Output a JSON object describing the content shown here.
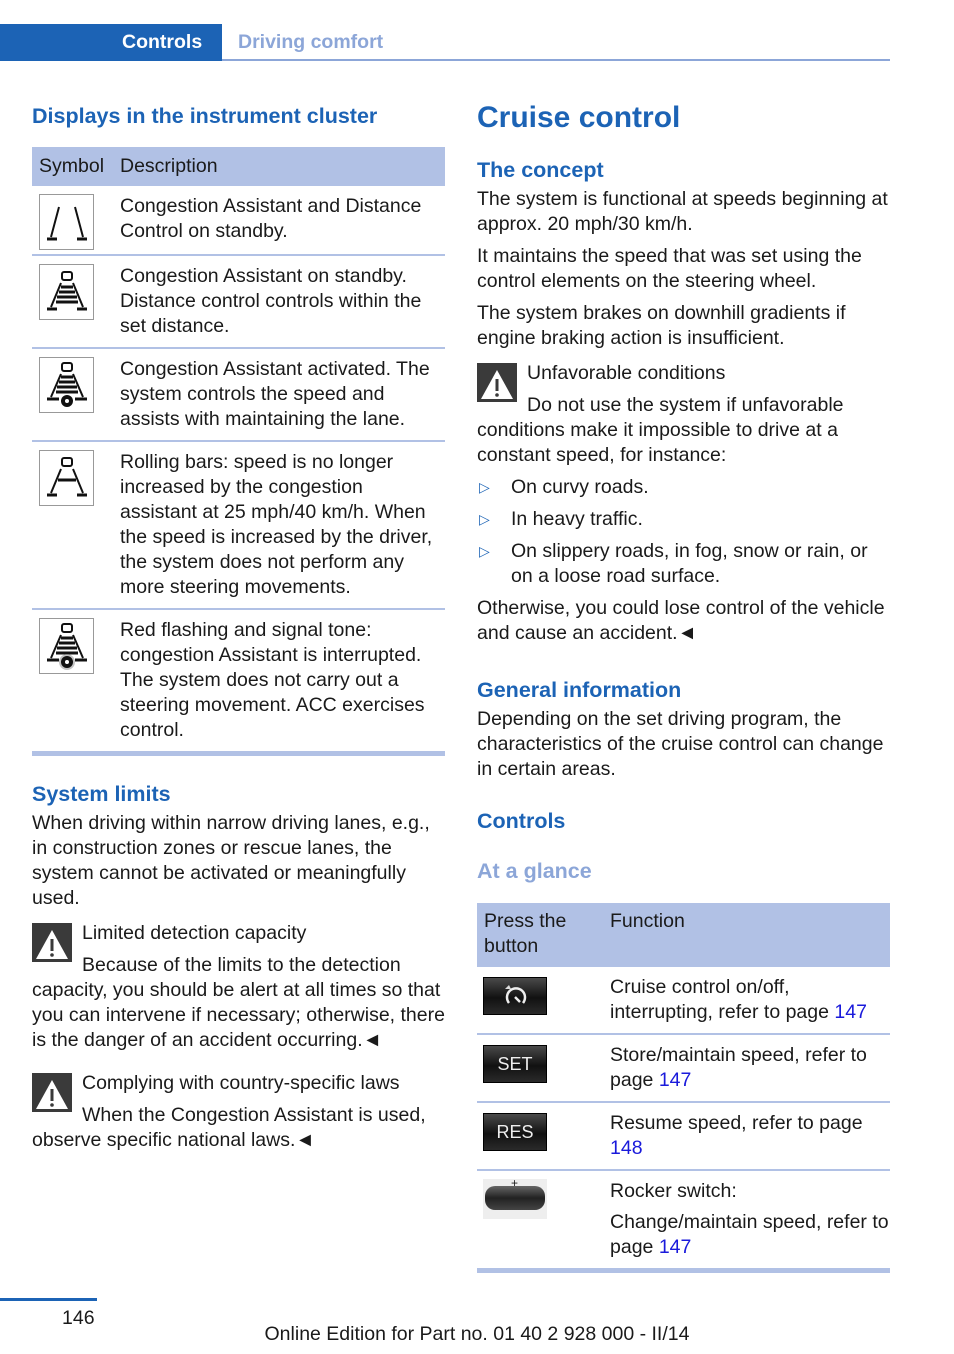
{
  "header": {
    "chapter": "Controls",
    "section": "Driving comfort"
  },
  "left": {
    "displays_heading": "Displays in the instrument cluster",
    "table": {
      "col_symbol": "Symbol",
      "col_description": "Description",
      "rows": [
        {
          "icon": "congestion-standby-lane-icon",
          "text": "Congestion Assistant and Distance Control on standby."
        },
        {
          "icon": "congestion-standby-car-bars-icon",
          "text": "Congestion Assistant on standby. Distance control controls within the set distance."
        },
        {
          "icon": "congestion-activated-steering-icon",
          "text": "Congestion Assistant activated. The system controls the speed and assists with maintaining the lane."
        },
        {
          "icon": "rolling-bars-icon",
          "text": "Rolling bars: speed is no longer increased by the congestion assistant at 25 mph/40 km/h. When the speed is increased by the driver, the system does not perform any more steering movements."
        },
        {
          "icon": "congestion-interrupted-icon",
          "text": "Red flashing and signal tone: congestion Assistant is interrupted. The system does not carry out a steering movement. ACC exercises control."
        }
      ]
    },
    "system_limits_heading": "System limits",
    "system_limits_text": "When driving within narrow driving lanes, e.g., in construction zones or rescue lanes, the system cannot be activated or meaningfully used.",
    "warning1": {
      "title": "Limited detection capacity",
      "body": "Because of the limits to the detection capacity, you should be alert at all times so that you can intervene if necessary; otherwise, there is the danger of an accident occurring.◄"
    },
    "warning2": {
      "title": "Complying with country-specific laws",
      "body": "When the Congestion Assistant is used, observe specific national laws.◄"
    }
  },
  "right": {
    "title": "Cruise control",
    "concept_heading": "The concept",
    "concept_p1": "The system is functional at speeds beginning at approx. 20 mph/30 km/h.",
    "concept_p2": "It maintains the speed that was set using the control elements on the steering wheel.",
    "concept_p3": "The system brakes on downhill gradients if engine braking action is insufficient.",
    "warning": {
      "title": "Unfavorable conditions",
      "body": "Do not use the system if unfavorable conditions make it impossible to drive at a constant speed, for instance:",
      "bullets": [
        "On curvy roads.",
        "In heavy traffic.",
        "On slippery roads, in fog, snow or rain, or on a loose road surface."
      ],
      "closing": "Otherwise, you could lose control of the vehicle and cause an accident.◄"
    },
    "general_heading": "General information",
    "general_text": "Depending on the set driving program, the characteristics of the cruise control can change in certain areas.",
    "controls_heading": "Controls",
    "glance_heading": "At a glance",
    "table": {
      "col_button": "Press the button",
      "col_function": "Function",
      "rows": [
        {
          "button_label": "",
          "button_icon": "cruise-control-onoff-icon",
          "text": "Cruise control on/off, interrupting, refer to page ",
          "page": "147",
          "prefix": ""
        },
        {
          "button_label": "SET",
          "button_icon": "set-button-icon",
          "text": "Store/maintain speed, refer to page ",
          "page": "147",
          "prefix": ""
        },
        {
          "button_label": "RES",
          "button_icon": "res-button-icon",
          "text": "Resume speed, refer to page ",
          "page": "148",
          "prefix": ""
        },
        {
          "button_label": "+",
          "button_icon": "rocker-switch-icon",
          "text": "Change/maintain speed, refer to page ",
          "page": "147",
          "prefix": "Rocker switch:"
        }
      ]
    }
  },
  "footer": {
    "page_number": "146",
    "edition": "Online Edition for Part no. 01 40 2 928 000 - II/14"
  },
  "colors": {
    "brand_blue": "#1c63b5",
    "light_blue": "#8ca6d8",
    "table_header": "#b1c1e5",
    "link": "#1a1adb"
  }
}
